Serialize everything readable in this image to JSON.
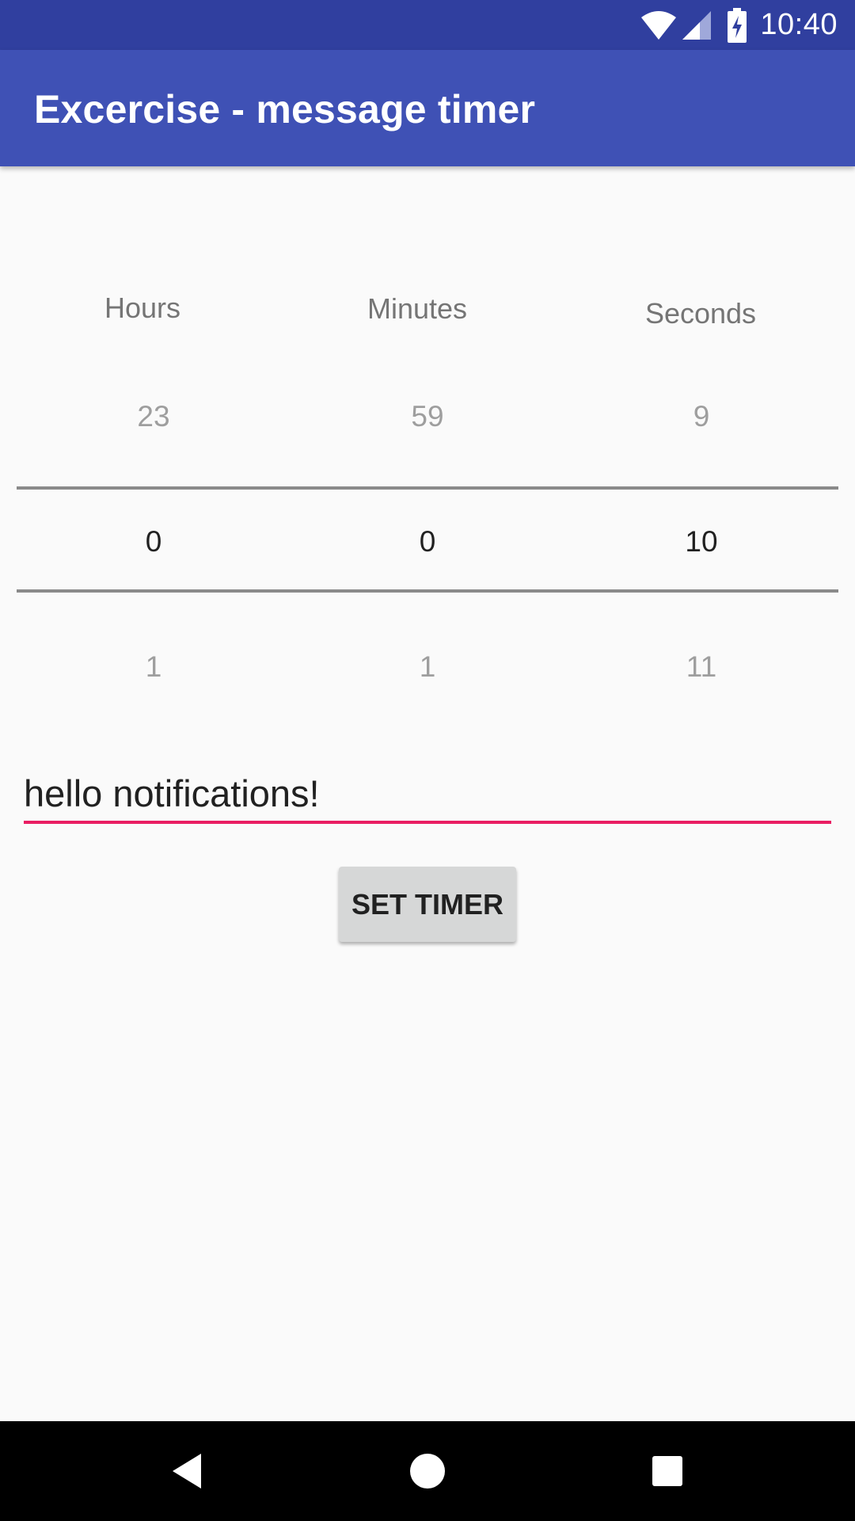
{
  "status_bar": {
    "time": "10:40",
    "icons": [
      "wifi-icon",
      "signal-icon",
      "battery-charging-icon"
    ]
  },
  "app_bar": {
    "title": "Excercise - message timer"
  },
  "picker": {
    "columns": [
      {
        "label": "Hours",
        "prev": "23",
        "selected": "0",
        "next": "1"
      },
      {
        "label": "Minutes",
        "prev": "59",
        "selected": "0",
        "next": "1"
      },
      {
        "label": "Seconds",
        "prev": "9",
        "selected": "10",
        "next": "11"
      }
    ]
  },
  "message": {
    "value": "hello notifications!"
  },
  "actions": {
    "set_timer_label": "SET TIMER"
  },
  "nav_bar": {
    "icons": [
      "back-icon",
      "home-icon",
      "recents-icon"
    ]
  },
  "colors": {
    "status_bar": "#303f9f",
    "app_bar": "#3f51b5",
    "accent": "#e91e63",
    "background": "#fafafa"
  }
}
